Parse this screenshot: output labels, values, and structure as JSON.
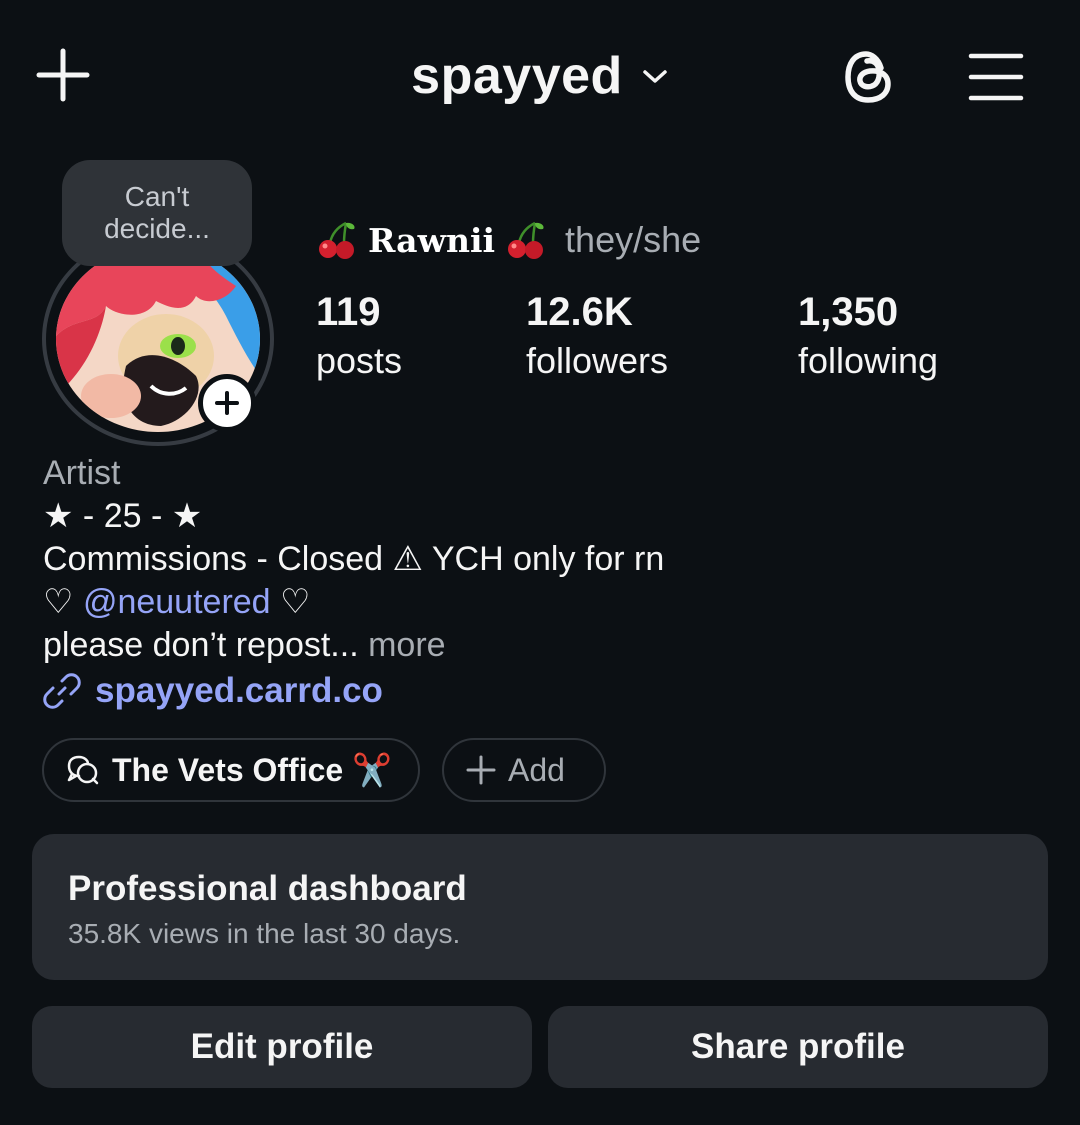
{
  "header": {
    "username": "spayyed",
    "new_post_icon": "plus-icon",
    "account_switch_icon": "chevron-down-icon",
    "threads_icon": "threads-icon",
    "menu_icon": "hamburger-menu-icon"
  },
  "profile": {
    "note": [
      "Can't",
      "decide..."
    ],
    "display_name": "Rawnii",
    "name_emoji": "cherry-icon",
    "pronouns": "they/she",
    "stats": [
      {
        "value": "119",
        "label": "posts"
      },
      {
        "value": "12.6K",
        "label": "followers"
      },
      {
        "value": "1,350",
        "label": "following"
      }
    ]
  },
  "bio": {
    "category": "Artist",
    "lines": [
      "★ - 25 - ★",
      "Commissions - Closed ⚠ YCH only for rn"
    ],
    "mention_prefix": "♡ ",
    "mention": "@neuutered",
    "mention_suffix": " ♡",
    "truncated_line": "please don’t repost...",
    "more": " more",
    "link": "spayyed.carrd.co"
  },
  "chips": {
    "channel_label": "The Vets Office ✂️",
    "add_label": "Add"
  },
  "dashboard": {
    "title": "Professional dashboard",
    "subtitle": "35.8K views in the last 30 days."
  },
  "actions": {
    "edit": "Edit profile",
    "share": "Share profile"
  },
  "colors": {
    "background": "#0c1014",
    "surface": "#272b31",
    "link": "#95a4f7",
    "muted": "#a8adb3"
  }
}
